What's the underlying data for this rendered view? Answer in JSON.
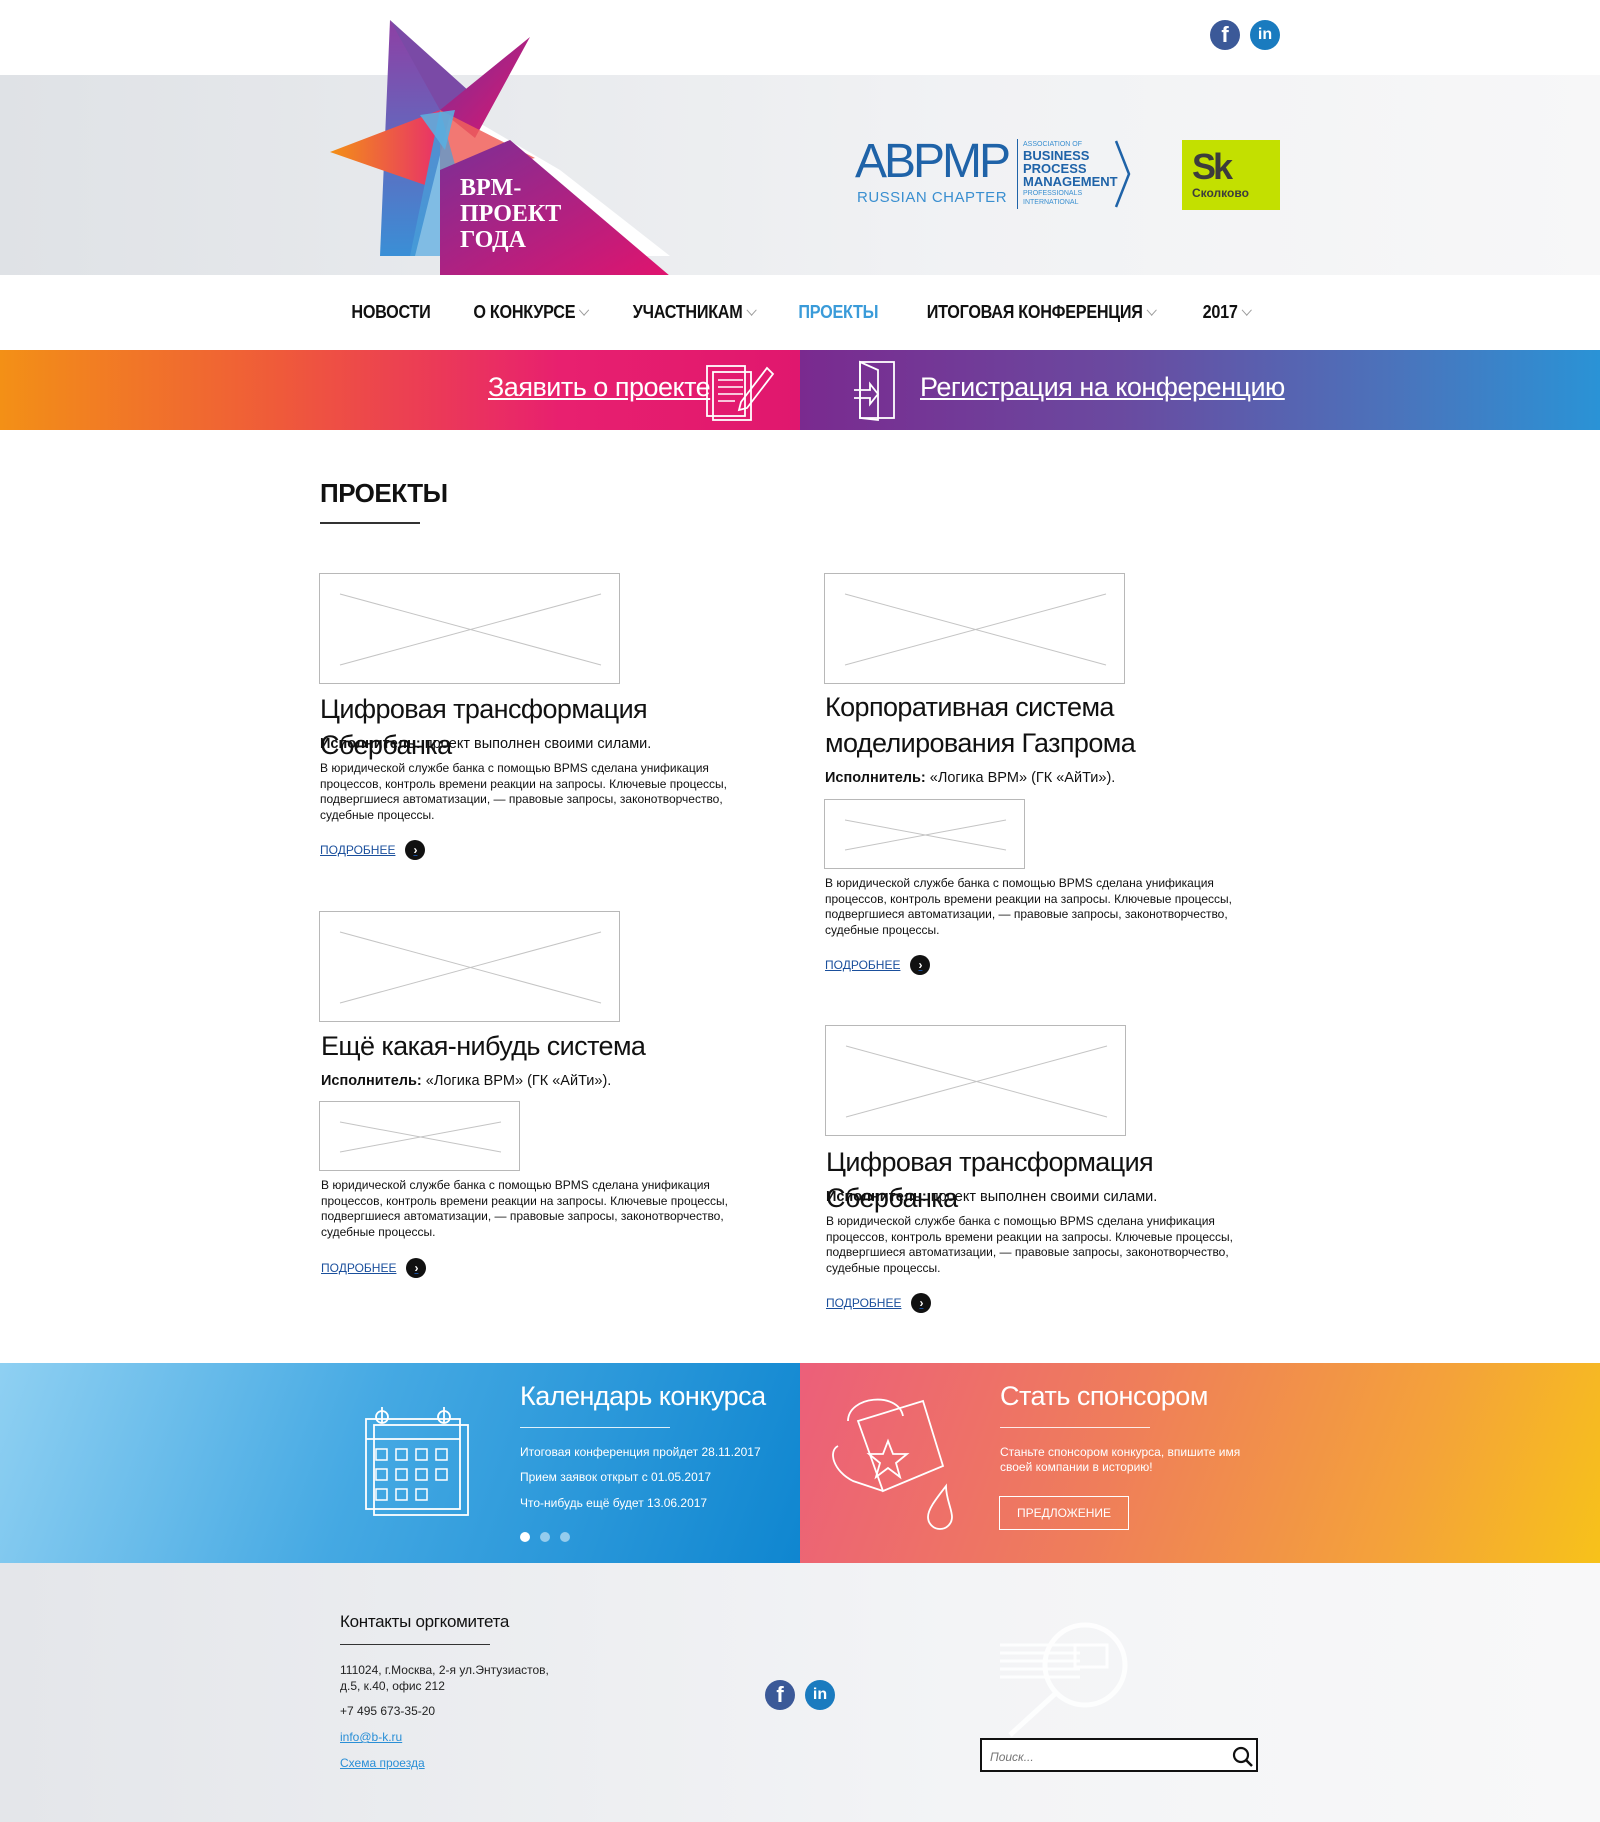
{
  "header": {
    "logo_line1": "BPM-",
    "logo_line2": "ПРОЕКТ",
    "logo_line3": "ГОДА",
    "abpmp_main": "ABPMP",
    "abpmp_sub": "RUSSIAN CHAPTER",
    "abpmp_assoc": "ASSOCIATION OF",
    "abpmp_b1": "BUSINESS",
    "abpmp_b2": "PROCESS",
    "abpmp_b3": "MANAGEMENT",
    "abpmp_prof": "PROFESSIONALS",
    "abpmp_intl": "INTERNATIONAL",
    "skolkovo_sk": "Sk",
    "skolkovo_name": "Сколково",
    "social_fb": "f",
    "social_li": "in"
  },
  "nav": {
    "items": [
      {
        "label": "НОВОСТИ"
      },
      {
        "label": "О КОНКУРСЕ"
      },
      {
        "label": "УЧАСТНИКАМ"
      },
      {
        "label": "ПРОЕКТЫ"
      },
      {
        "label": "ИТОГОВАЯ КОНФЕРЕНЦИЯ"
      },
      {
        "label": "2017"
      }
    ],
    "active": "ПРОЕКТЫ"
  },
  "banners": {
    "apply": "Заявить о проекте",
    "register": "Регистрация на конференцию"
  },
  "page": {
    "title": "ПРОЕКТЫ"
  },
  "projects": [
    {
      "title": "Цифровая трансформация Сбербанка",
      "performer_label": "Исполнитель:",
      "performer": "проект выполнен своими силами.",
      "description": "В юридической службе банка с помощью BPMS сделана унификация процессов, контроль времени реакции на запросы. Ключевые процессы, подвергшиеся автоматизации, — правовые запросы, законотворчество, судебные процессы.",
      "more": "ПОДРОБНЕЕ"
    },
    {
      "title": "Корпоративная система моделирования Газпрома",
      "performer_label": "Исполнитель:",
      "performer": "«Логика BPM» (ГК «АйТи»).",
      "description": "В юридической службе банка с помощью BPMS сделана унификация процессов, контроль времени реакции на запросы. Ключевые процессы, подвергшиеся автоматизации, — правовые запросы, законотворчество, судебные процессы.",
      "more": "ПОДРОБНЕЕ"
    },
    {
      "title": "Ещё какая-нибудь система",
      "performer_label": "Исполнитель:",
      "performer": "«Логика BPM» (ГК «АйТи»).",
      "description": "В юридической службе банка с помощью BPMS сделана унификация процессов, контроль времени реакции на запросы. Ключевые процессы, подвергшиеся автоматизации, — правовые запросы, законотворчество, судебные процессы.",
      "more": "ПОДРОБНЕЕ"
    },
    {
      "title": "Цифровая трансформация Сбербанка",
      "performer_label": "Исполнитель:",
      "performer": "проект выполнен своими силами.",
      "description": "В юридической службе банка с помощью BPMS сделана унификация процессов, контроль времени реакции на запросы. Ключевые процессы, подвергшиеся автоматизации, — правовые запросы, законотворчество, судебные процессы.",
      "more": "ПОДРОБНЕЕ"
    }
  ],
  "calendar": {
    "title": "Календарь конкурса",
    "lines": [
      "Итоговая конференция пройдет 28.11.2017",
      "Прием заявок открыт с 01.05.2017",
      "Что-нибудь ещё будет 13.06.2017"
    ]
  },
  "sponsor": {
    "title": "Стать спонсором",
    "text": "Станьте спонсором конкурса, впишите имя своей компании в историю!",
    "button": "ПРЕДЛОЖЕНИЕ"
  },
  "footer": {
    "title": "Контакты оргкомитета",
    "address": "111024, г.Москва, 2-я ул.Энтузиастов, д.5, к.40, офис 212",
    "phone": "+7 495 673-35-20",
    "email": "info@b-k.ru",
    "map_link": "Схема проезда",
    "search_placeholder": "Поиск..."
  },
  "colors": {
    "accent_blue": "#3a9bd9",
    "link_blue": "#1a4f9c",
    "footer_link": "#2a8fd6"
  }
}
